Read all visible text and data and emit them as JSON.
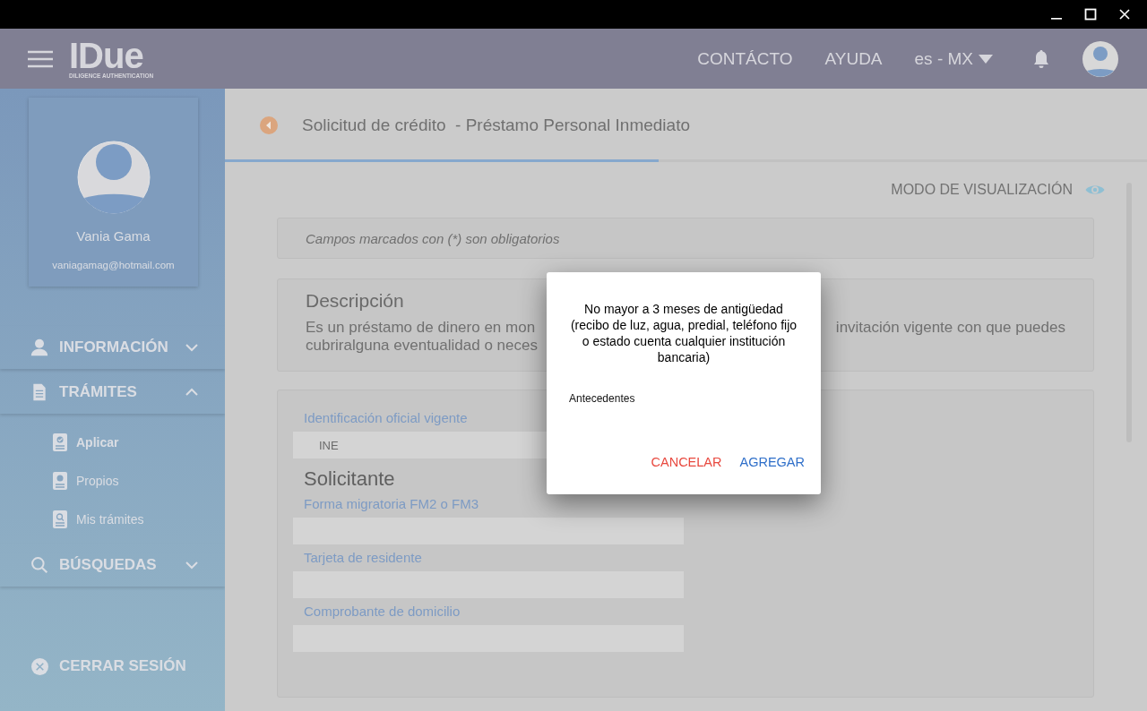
{
  "header": {
    "logo": "IDue",
    "logo_tagline": "DILIGENCE AUTHENTICATION",
    "nav": [
      "CONTÁCTO",
      "AYUDA"
    ],
    "language": "es - MX"
  },
  "profile": {
    "name": "Vania Gama",
    "email": "vaniagamag@hotmail.com"
  },
  "menu": [
    {
      "label": "INFORMACIÓN",
      "expanded": false
    },
    {
      "label": "TRÁMITES",
      "expanded": true,
      "children": [
        {
          "label": "Aplicar",
          "selected": true
        },
        {
          "label": "Propios",
          "selected": false
        },
        {
          "label": "Mis trámites",
          "selected": false
        }
      ]
    },
    {
      "label": "BÚSQUEDAS",
      "expanded": false
    }
  ],
  "logout": "CERRAR SESIÓN",
  "page": {
    "title": "Solicitud de crédito  - Préstamo Personal Inmediato",
    "progress": {
      "level": 0.47
    },
    "view_mode": "MODO DE VISUALIZACIÓN",
    "required_note": "Campos marcados con (*) son obligatorios"
  },
  "description": {
    "heading": "Descripción",
    "line_1_left": "Es un préstamo de dinero en mon",
    "line_1_right": "invitación vigente con que puedes",
    "line_2_left": "cubriralguna eventualidad o neces"
  },
  "form": [
    {
      "kind": "field",
      "label": "Identificación oficial vigente",
      "value": "INE"
    },
    {
      "kind": "heading",
      "label": "Solicitante"
    },
    {
      "kind": "field",
      "label": "Forma migratoria FM2 o FM3"
    },
    {
      "kind": "field",
      "label": "Tarjeta de residente"
    },
    {
      "kind": "field",
      "label": "Comprobante de domicilio"
    }
  ],
  "dialog": {
    "message": "No mayor a 3 meses de antigüedad (recibo de luz, agua, predial, teléfono fijo o estado cuenta cualquier institución bancaria)",
    "field_label": "Antecedentes",
    "buttons": [
      {
        "label": "CANCELAR",
        "kind": "cancel"
      },
      {
        "label": "AGREGAR",
        "kind": "confirm"
      }
    ]
  }
}
